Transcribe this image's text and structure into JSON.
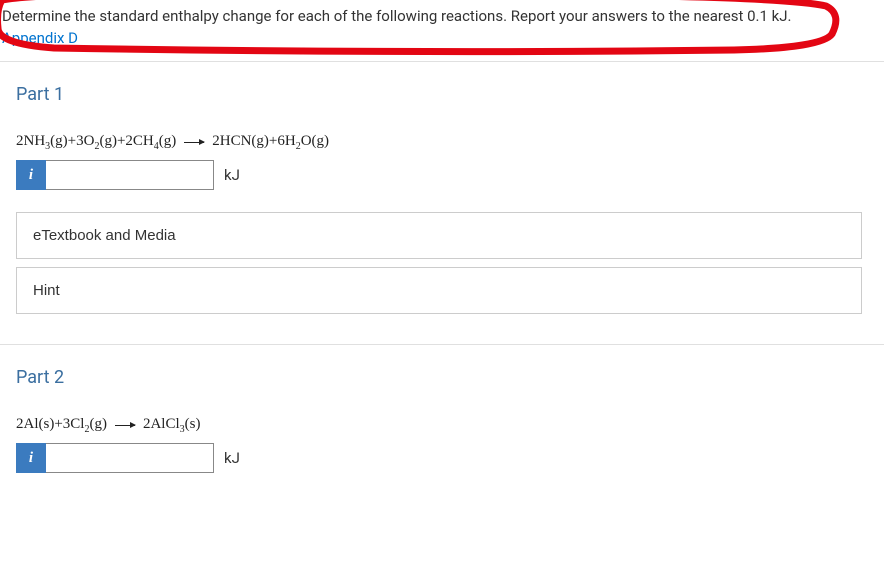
{
  "header": {
    "prompt": "Determine the standard enthalpy change for each of the following reactions. Report your answers to the nearest 0.1 kJ.",
    "appendix_link": "Appendix D"
  },
  "part1": {
    "title": "Part 1",
    "equation_left": "2NH₃(g)+3O₂(g)+2CH₄(g)",
    "equation_right": "2HCN(g)+6H₂O(g)",
    "info_symbol": "i",
    "unit": "kJ",
    "etextbook_label": "eTextbook and Media",
    "hint_label": "Hint"
  },
  "part2": {
    "title": "Part 2",
    "equation_left": "2Al(s)+3Cl₂(g)",
    "equation_right": "2AlCl₃(s)",
    "info_symbol": "i",
    "unit": "kJ"
  }
}
